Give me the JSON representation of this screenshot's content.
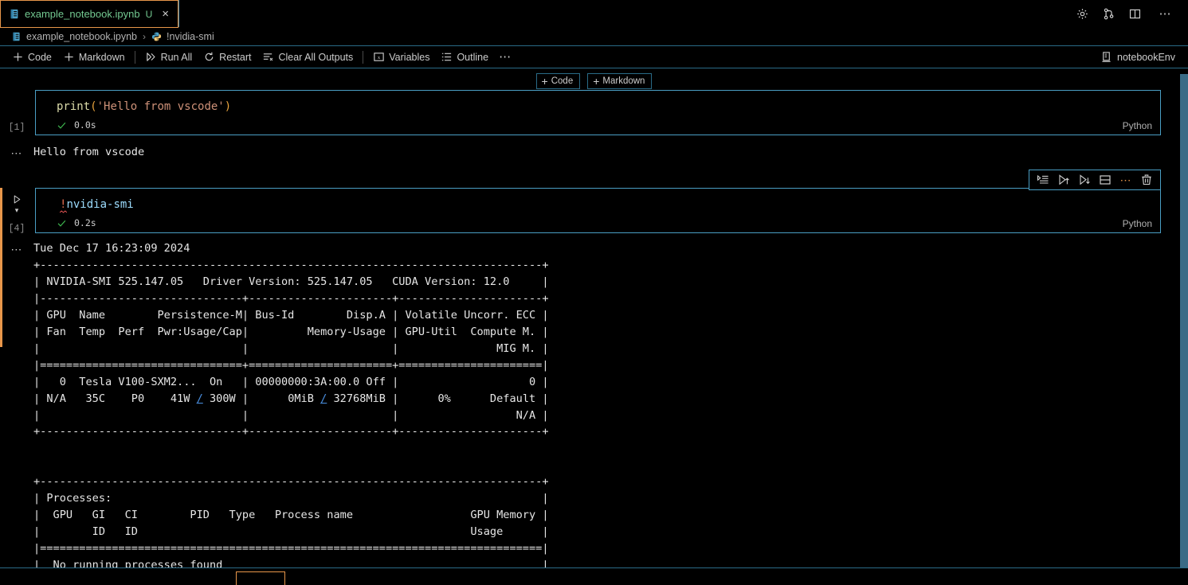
{
  "tab": {
    "label": "example_notebook.ipynb",
    "dirty_badge": "U",
    "close": "×",
    "icon": "notebook-icon"
  },
  "title_actions": [
    {
      "name": "settings-gear-icon",
      "label": "Settings"
    },
    {
      "name": "source-control-icon",
      "label": "Source Control"
    },
    {
      "name": "split-editor-icon",
      "label": "Split Editor"
    },
    {
      "name": "more-actions-icon",
      "label": "⋯"
    }
  ],
  "breadcrumb": {
    "file": "example_notebook.ipynb",
    "separator": "›",
    "symbol": "!nvidia-smi"
  },
  "toolbar": {
    "code_label": "Code",
    "markdown_label": "Markdown",
    "run_all_label": "Run All",
    "restart_label": "Restart",
    "clear_outputs_label": "Clear All Outputs",
    "variables_label": "Variables",
    "outline_label": "Outline",
    "more_label": "⋯",
    "kernel_label": "notebookEnv"
  },
  "insert_bar": {
    "code_label": "Code",
    "markdown_label": "Markdown",
    "plus": "+"
  },
  "cells": [
    {
      "exec_count": "[1]",
      "code_fn": "print",
      "code_open": "(",
      "code_str": "'Hello from vscode'",
      "code_close": ")",
      "duration": "0.0s",
      "language": "Python",
      "output": "Hello from vscode",
      "output_dots": "⋯"
    },
    {
      "exec_count": "[4]",
      "bang": "!",
      "command": "nvidia-smi",
      "duration": "0.2s",
      "language": "Python",
      "output_dots": "⋯"
    }
  ],
  "cell_toolbar": [
    {
      "name": "run-by-line-icon",
      "label": "Run by Line"
    },
    {
      "name": "execute-above-icon",
      "label": "Execute Above Cells"
    },
    {
      "name": "execute-below-icon",
      "label": "Execute Cell and Below"
    },
    {
      "name": "split-cell-icon",
      "label": "Split Cell"
    },
    {
      "name": "more-actions-icon",
      "label": "⋯"
    },
    {
      "name": "delete-cell-icon",
      "label": "Delete Cell"
    }
  ],
  "nvidia_output": {
    "timestamp": "Tue Dec 17 16:23:09 2024",
    "line_top": "+-----------------------------------------------------------------------------+",
    "line_header": "| NVIDIA-SMI 525.147.05   Driver Version: 525.147.05   CUDA Version: 12.0     |",
    "line_sep1": "|-------------------------------+----------------------+----------------------+",
    "line_cols1": "| GPU  Name        Persistence-M| Bus-Id        Disp.A | Volatile Uncorr. ECC |",
    "line_cols2": "| Fan  Temp  Perf  Pwr:Usage/Cap|         Memory-Usage | GPU-Util  Compute M. |",
    "line_cols3": "|                               |                      |               MIG M. |",
    "line_eq1": "|===============================+======================+======================|",
    "gpu_row1": "|   0  Tesla V100-SXM2...  On   | 00000000:3A:00.0 Off |                    0 |",
    "gpu_row2_a": "| N/A   35C    P0    41W ",
    "gpu_row2_link1": "/",
    "gpu_row2_b": " 300W |      0MiB ",
    "gpu_row2_link2": "/",
    "gpu_row2_c": " 32768MiB |      0%      Default |",
    "gpu_row3": "|                               |                      |                  N/A |",
    "line_bottom1": "+-------------------------------+----------------------+----------------------+",
    "blank": "",
    "line_proc_top": "+-----------------------------------------------------------------------------+",
    "proc_title": "| Processes:                                                                  |",
    "proc_cols1": "|  GPU   GI   CI        PID   Type   Process name                  GPU Memory |",
    "proc_cols2": "|        ID   ID                                                   Usage      |",
    "proc_eq": "|=============================================================================|",
    "proc_none": "|  No running processes found                                                 |",
    "line_proc_bottom": "+-----------------------------------------------------------------------------+"
  },
  "colors": {
    "focus_orange": "#e8964a",
    "cell_border_blue": "#4a9ec4",
    "tab_green": "#73c991",
    "link_blue": "#4a90e2",
    "check_green": "#3fb950",
    "background": "#000000"
  }
}
